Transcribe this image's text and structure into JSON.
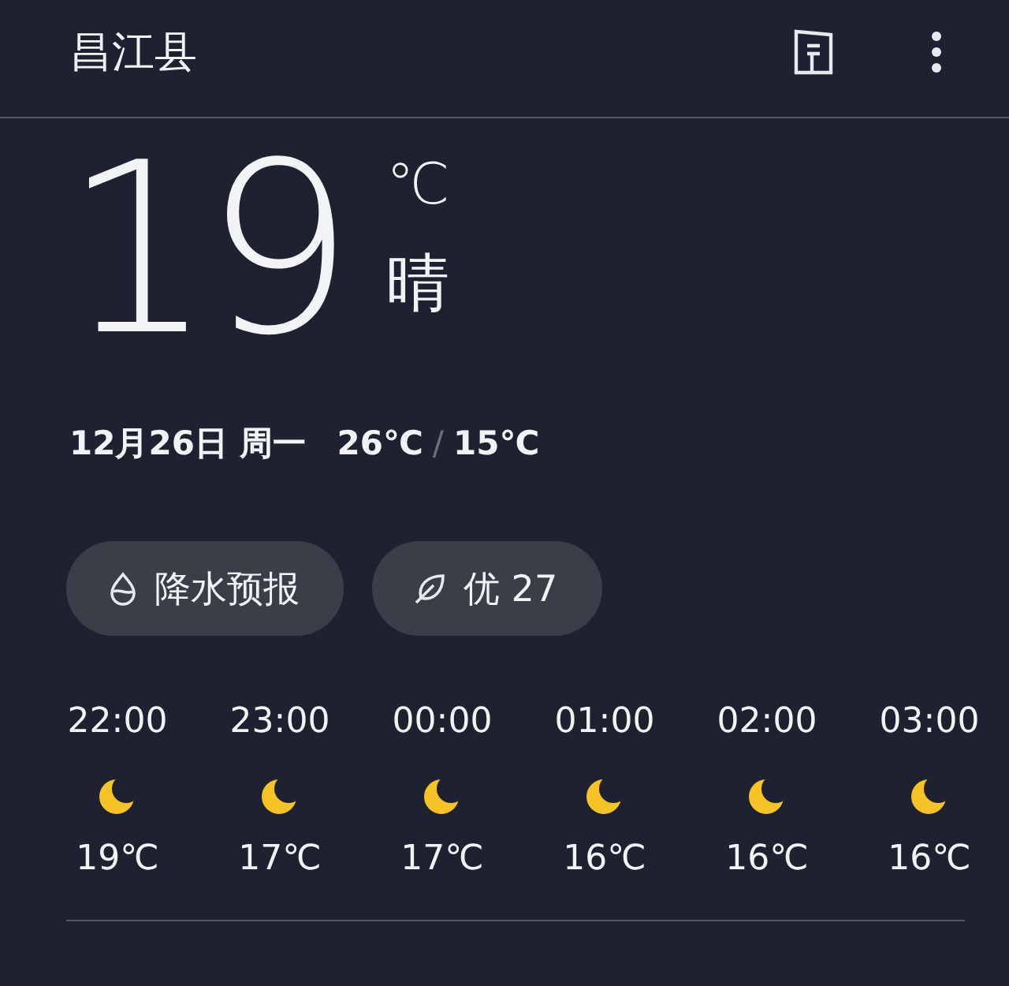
{
  "header": {
    "title": "昌江县"
  },
  "current": {
    "temperature": "19",
    "unit": "℃",
    "condition": "晴"
  },
  "summary": {
    "date": "12月26日 周一",
    "high": "26℃",
    "separator": "/",
    "low": "15℃"
  },
  "chips": [
    {
      "kind": "rain",
      "label": "降水预报"
    },
    {
      "kind": "air",
      "label": "优 27"
    }
  ],
  "hourly": [
    {
      "time": "22:00",
      "kind": "moon",
      "temp": "19℃"
    },
    {
      "time": "23:00",
      "kind": "moon",
      "temp": "17℃"
    },
    {
      "time": "00:00",
      "kind": "moon",
      "temp": "17℃"
    },
    {
      "time": "01:00",
      "kind": "moon",
      "temp": "16℃"
    },
    {
      "time": "02:00",
      "kind": "moon",
      "temp": "16℃"
    },
    {
      "time": "03:00",
      "kind": "moon",
      "temp": "16℃"
    }
  ]
}
